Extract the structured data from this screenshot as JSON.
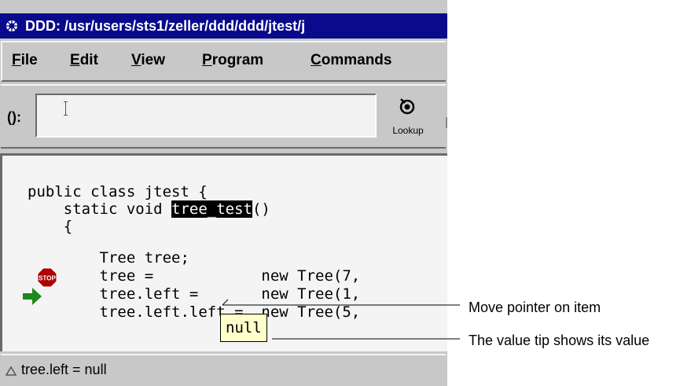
{
  "window": {
    "title": "DDD: /usr/users/sts1/zeller/ddd/ddd/jtest/j"
  },
  "menubar": {
    "items": [
      {
        "label": "File",
        "mnemonic": "F",
        "rest": "ile"
      },
      {
        "label": "Edit",
        "mnemonic": "E",
        "rest": "dit"
      },
      {
        "label": "View",
        "mnemonic": "V",
        "rest": "iew"
      },
      {
        "label": "Program",
        "mnemonic": "P",
        "rest": "rogram"
      },
      {
        "label": "Commands",
        "mnemonic": "C",
        "rest": "ommands"
      }
    ]
  },
  "toolbar": {
    "arg_label": "():",
    "arg_value": "",
    "lookup_label": "Lookup"
  },
  "source": {
    "lines": [
      "public class jtest {",
      "    static void ",
      "    {",
      "        Tree tree;",
      "        tree =            new Tree(7,",
      "        tree.left =       new Tree(1,",
      "        tree.left.left =  new Tree(5,"
    ],
    "highlighted_word": "tree_test",
    "line2_suffix": "()"
  },
  "value_tip": "null",
  "status": {
    "text": "tree.left = null"
  },
  "annotations": {
    "pointer": "Move pointer on item",
    "tip": "The value tip shows its value"
  },
  "colors": {
    "titlebar": "#0a0a8c",
    "window": "#c8c8c8",
    "source_bg": "#f4f4f4",
    "tip_bg": "#ffffcc",
    "stop": "#b00000",
    "pc_arrow": "#1a8a1a"
  }
}
